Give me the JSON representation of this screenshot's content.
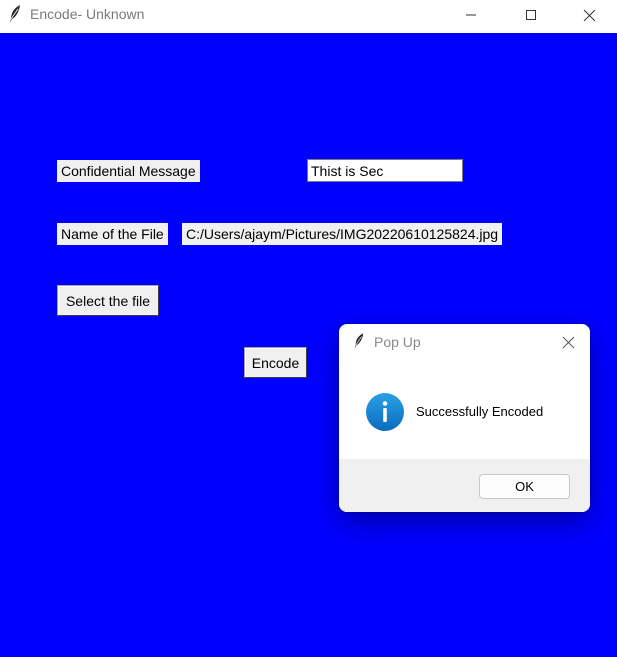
{
  "window": {
    "title": "Encode- Unknown",
    "icon": "feather-icon",
    "controls": [
      "minimize-icon",
      "maximize-icon",
      "close-icon"
    ],
    "background_color": "#0000ff"
  },
  "form": {
    "message_label": "Confidential Message",
    "message_value": "Thist is Sec",
    "file_label": "Name of the File",
    "file_path": "C:/Users/ajaym/Pictures/IMG20220610125824.jpg",
    "select_button": "Select the file",
    "encode_button": "Encode"
  },
  "popup": {
    "title": "Pop Up",
    "icon": "info-icon",
    "message": "Successfully Encoded",
    "ok_button": "OK"
  }
}
